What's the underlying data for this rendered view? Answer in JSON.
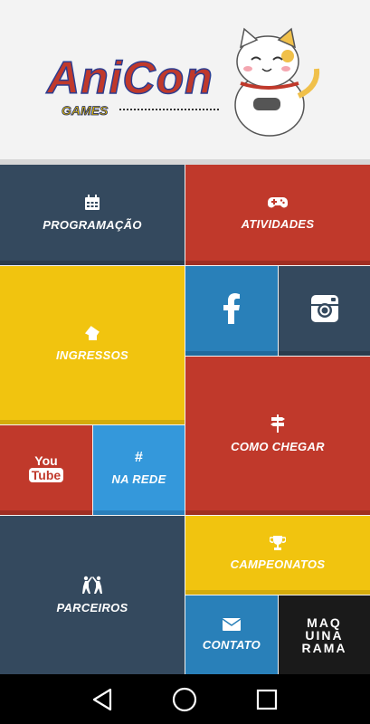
{
  "header": {
    "logo_text": "AniCon",
    "logo_sub": "GAMES"
  },
  "tiles": {
    "programacao": {
      "label": "PROGRAMAÇÃO",
      "icon": "calendar-icon",
      "color": "#34495e"
    },
    "atividades": {
      "label": "ATIVIDADES",
      "icon": "gamepad-icon",
      "color": "#c0392b"
    },
    "ingressos": {
      "label": "INGRESSOS",
      "icon": "ticket-icon",
      "color": "#f1c40f"
    },
    "facebook": {
      "icon": "facebook-icon",
      "color": "#2980b9"
    },
    "instagram": {
      "icon": "instagram-icon",
      "color": "#34495e"
    },
    "youtube": {
      "icon": "youtube-icon",
      "icon_text_top": "You",
      "icon_text_bottom": "Tube",
      "color": "#c0392b"
    },
    "na_rede": {
      "label": "NA REDE",
      "icon_text": "#",
      "color": "#3498db"
    },
    "como_chegar": {
      "label": "COMO CHEGAR",
      "icon": "signpost-icon",
      "color": "#c0392b"
    },
    "parceiros": {
      "label": "PARCEIROS",
      "icon": "high-five-icon",
      "color": "#34495e"
    },
    "campeonatos": {
      "label": "CAMPEONATOS",
      "icon": "trophy-icon",
      "color": "#f1c40f"
    },
    "contato": {
      "label": "CONTATO",
      "icon": "envelope-icon",
      "color": "#2980b9"
    },
    "maquinarama": {
      "logo_lines": [
        "MAQ",
        "UINA",
        "RAMA"
      ],
      "color": "#1a1a1a"
    }
  },
  "navbar": {
    "back": "back-icon",
    "home": "home-icon",
    "recents": "recents-icon"
  }
}
